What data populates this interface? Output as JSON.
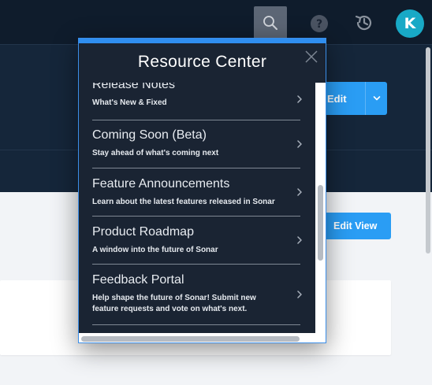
{
  "topbar": {
    "icons": [
      "search-icon",
      "help-icon",
      "history-icon"
    ],
    "avatar_initial": "K",
    "avatar_color": "#18a9c6"
  },
  "toolbar": {
    "edit_label": "Edit",
    "edit_view_label": "Edit View"
  },
  "resource_center": {
    "title": "Resource Center",
    "accent_color": "#2f8ef0",
    "items": [
      {
        "title": "Release Notes",
        "description": "What's New & Fixed"
      },
      {
        "title": "Coming Soon (Beta)",
        "description": "Stay ahead of what's coming next"
      },
      {
        "title": "Feature Announcements",
        "description": "Learn about the latest features released in Sonar"
      },
      {
        "title": "Product Roadmap",
        "description": "A window into the future of Sonar"
      },
      {
        "title": "Feedback Portal",
        "description": "Help shape the future of Sonar! Submit new feature requests and vote on what's next."
      }
    ]
  }
}
